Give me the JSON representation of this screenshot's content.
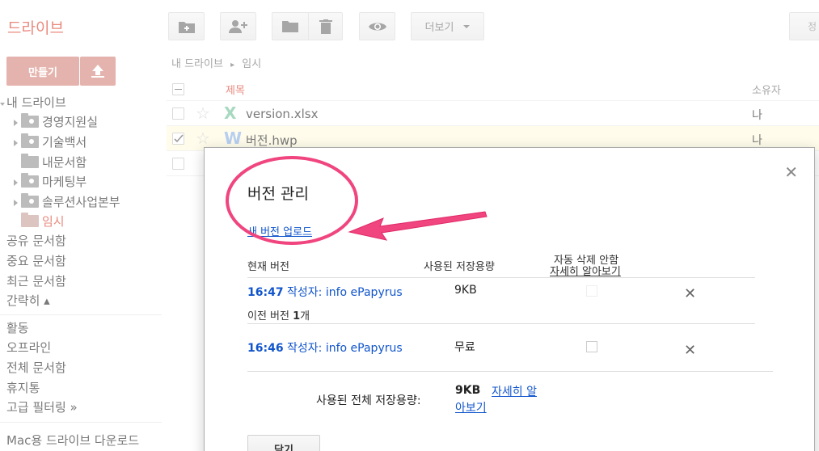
{
  "app": {
    "logo": "드라이브"
  },
  "toolbar": {
    "more_label": "더보기",
    "right_partial": "정"
  },
  "sidebar": {
    "create_label": "만들기",
    "items": [
      {
        "label": "내 드라이브"
      },
      {
        "label": "경영지원실"
      },
      {
        "label": "기술백서"
      },
      {
        "label": "내문서함"
      },
      {
        "label": "마케팅부"
      },
      {
        "label": "솔루션사업본부"
      },
      {
        "label": "임시"
      },
      {
        "label": "공유 문서함"
      },
      {
        "label": "중요 문서함"
      },
      {
        "label": "최근 문서함"
      },
      {
        "label": "간략히 ▴"
      },
      {
        "label": "활동"
      },
      {
        "label": "오프라인"
      },
      {
        "label": "전체 문서함"
      },
      {
        "label": "휴지통"
      },
      {
        "label": "고급 필터링 »"
      },
      {
        "label": "Mac용 드라이브 다운로드"
      }
    ]
  },
  "breadcrumb": {
    "root": "내 드라이브",
    "sep": "▸",
    "current": "임시"
  },
  "list": {
    "col_title": "제목",
    "col_owner": "소유자",
    "rows": [
      {
        "icon": "X",
        "icon_color": "#7ac59e",
        "name": "version.xlsx",
        "owner": "나",
        "selected": false
      },
      {
        "icon": "W",
        "icon_color": "#8fb4e8",
        "name": "버전.hwp",
        "owner": "나",
        "selected": true
      }
    ]
  },
  "dialog": {
    "title": "버전 관리",
    "upload_link": "새 버전 업로드",
    "col_current": "현재 버전",
    "col_storage": "사용된 저장용량",
    "col_autodelete": "자동 삭제 안함",
    "learn_more": "자세히 알아보기",
    "versions": [
      {
        "time": "16:47",
        "author_prefix": "작성자:",
        "author": "info ePapyrus",
        "size": "9KB"
      },
      {
        "time": "16:46",
        "author_prefix": "작성자:",
        "author": "info ePapyrus",
        "size": "무료"
      }
    ],
    "prev_label": "이전 버전",
    "prev_count": "1",
    "prev_suffix": "개",
    "total_label": "사용된 전체 저장용량:",
    "total_value": "9KB",
    "total_link": "자세히 알아보기",
    "close_label": "닫기"
  },
  "colors": {
    "brand": "#dd4b39",
    "link": "#1155cc",
    "annotation": "#f0457e"
  }
}
